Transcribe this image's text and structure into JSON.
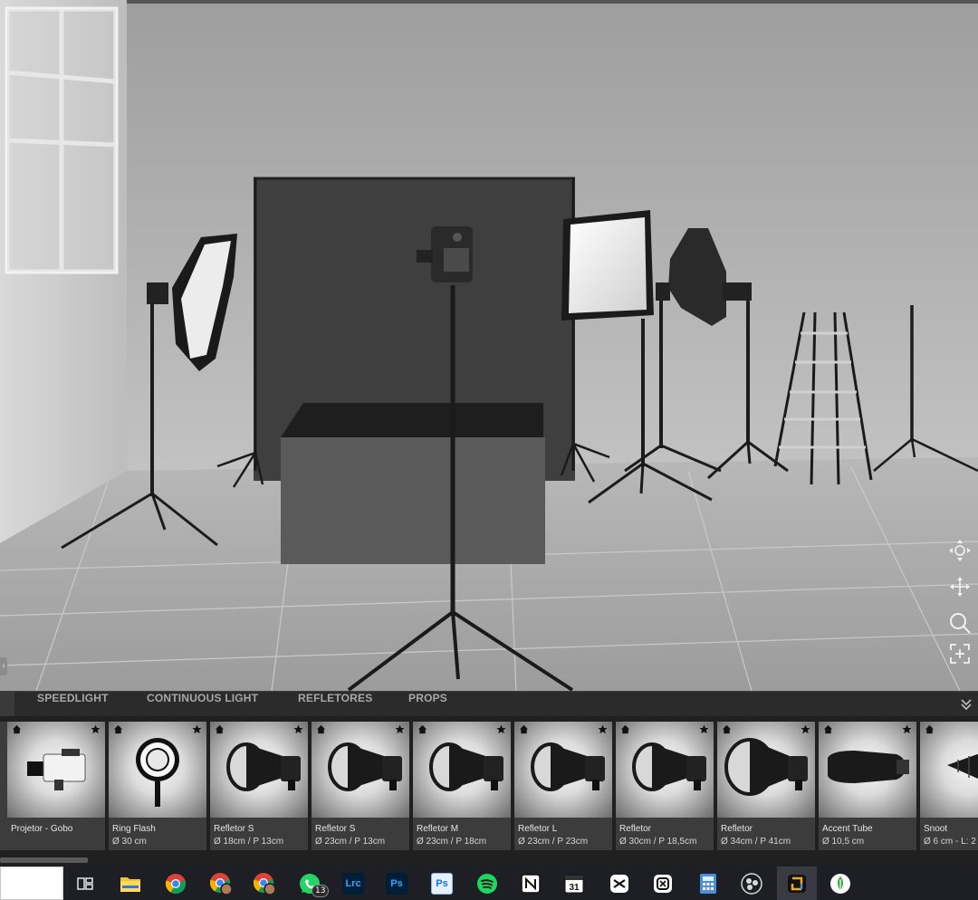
{
  "panel": {
    "tabs": [
      {
        "label": "SPEEDLIGHT"
      },
      {
        "label": "CONTINUOUS LIGHT"
      },
      {
        "label": "REFLETORES"
      },
      {
        "label": "PROPS"
      }
    ],
    "collapse_icon": "chevron-double-down-icon"
  },
  "library": {
    "items": [
      {
        "name": "Projetor - Gobo",
        "size": "",
        "icon": "gobo-projector-icon"
      },
      {
        "name": "Ring Flash",
        "size": "Ø 30 cm",
        "icon": "ring-flash-icon"
      },
      {
        "name": "Refletor S",
        "size": "Ø 18cm / P 13cm",
        "icon": "reflector-icon"
      },
      {
        "name": "Refletor S",
        "size": "Ø 23cm / P 13cm",
        "icon": "reflector-icon"
      },
      {
        "name": "Refletor M",
        "size": "Ø 23cm / P 18cm",
        "icon": "reflector-icon"
      },
      {
        "name": "Refletor L",
        "size": "Ø 23cm / P 23cm",
        "icon": "reflector-icon"
      },
      {
        "name": "Refletor",
        "size": "Ø 30cm / P 18,5cm",
        "icon": "reflector-icon"
      },
      {
        "name": "Refletor",
        "size": "Ø 34cm / P 41cm",
        "icon": "reflector-icon"
      },
      {
        "name": "Accent Tube",
        "size": "Ø 10,5 cm",
        "icon": "accent-tube-icon"
      },
      {
        "name": "Snoot",
        "size": "Ø 6 cm - L: 2",
        "icon": "snoot-icon"
      }
    ]
  },
  "viewport_tools": [
    {
      "icon": "orbit-icon"
    },
    {
      "icon": "pan-icon"
    },
    {
      "icon": "zoom-icon"
    },
    {
      "icon": "fit-view-icon"
    }
  ],
  "taskbar": {
    "items": [
      {
        "icon": "task-view-icon"
      },
      {
        "icon": "file-explorer-icon"
      },
      {
        "icon": "chrome-icon"
      },
      {
        "icon": "chrome-profile-icon"
      },
      {
        "icon": "chrome-profile-icon"
      },
      {
        "icon": "whatsapp-icon",
        "badge": "13"
      },
      {
        "icon": "lightroom-classic-icon",
        "text": "Lrc"
      },
      {
        "icon": "photoshop-icon",
        "text": "Ps"
      },
      {
        "icon": "photoshop-express-icon",
        "text": "Ps"
      },
      {
        "icon": "spotify-icon"
      },
      {
        "icon": "notion-icon"
      },
      {
        "icon": "calendar-icon",
        "text": "31"
      },
      {
        "icon": "capcut-icon"
      },
      {
        "icon": "app-icon"
      },
      {
        "icon": "calculator-icon"
      },
      {
        "icon": "obs-icon"
      },
      {
        "icon": "studio-app-icon"
      },
      {
        "icon": "leaf-app-icon"
      }
    ]
  },
  "colors": {
    "backdrop": "#3f3f3f",
    "panel": "#2b2b2b",
    "card": "#3c3c3c",
    "whatsapp": "#25d366",
    "spotify": "#1ed760",
    "lightroom": "#31a8ff",
    "photoshop": "#31a8ff"
  }
}
